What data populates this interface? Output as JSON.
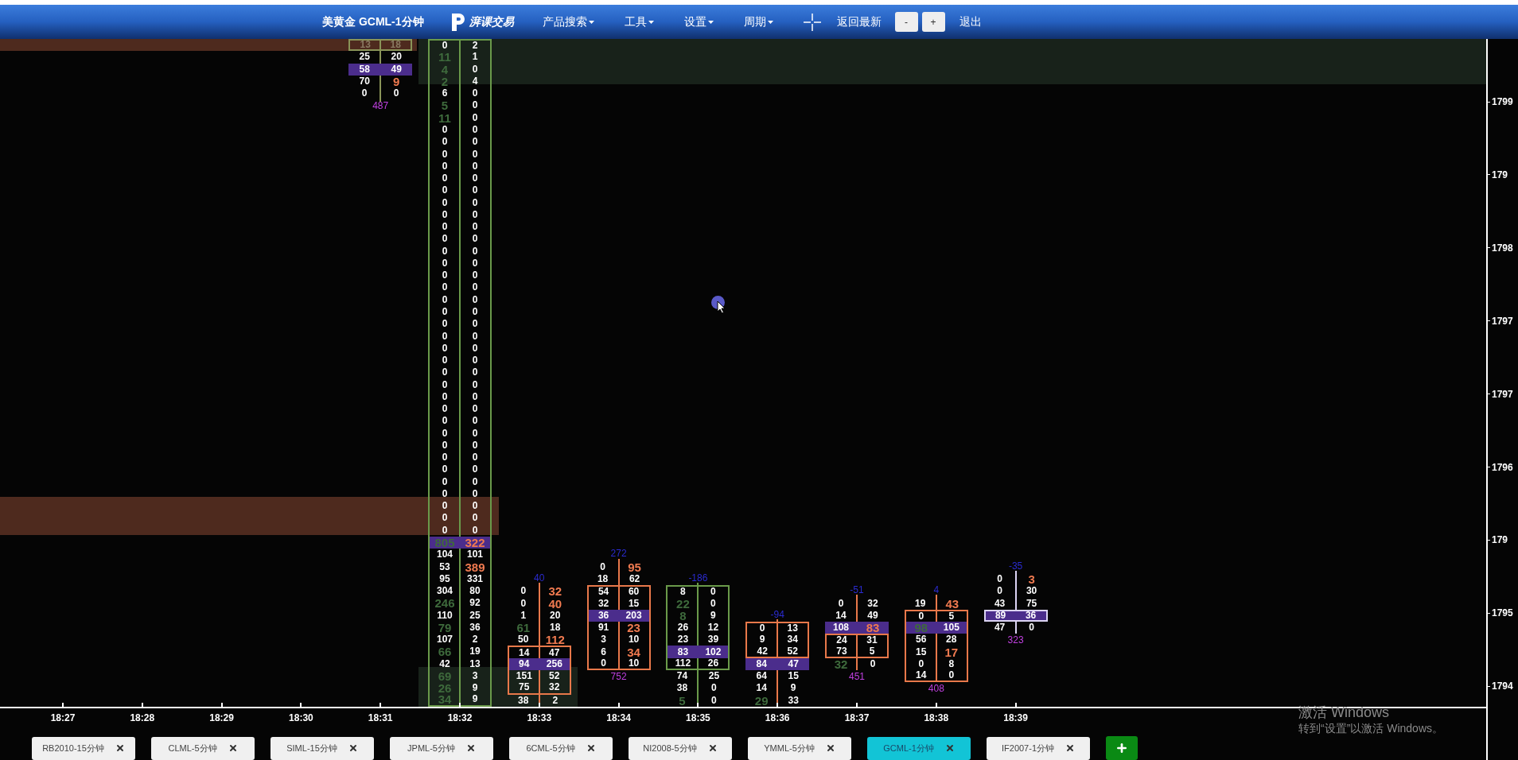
{
  "header": {
    "title": "美黄金 GCML-1分钟",
    "logo_text": "湃课交易",
    "menus": [
      {
        "label": "产品搜索",
        "dropdown": true
      },
      {
        "label": "工具",
        "dropdown": true
      },
      {
        "label": "设置",
        "dropdown": true
      },
      {
        "label": "周期",
        "dropdown": true
      }
    ],
    "reset_button": "返回最新",
    "zoom_out": "-",
    "zoom_in": "+",
    "exit": "退出"
  },
  "chart": {
    "price_labels": [
      "1799",
      "179",
      "1798",
      "1797",
      "1797",
      "1796",
      "179",
      "1795",
      "1794"
    ],
    "time_labels": [
      "18:27",
      "18:28",
      "18:29",
      "18:30",
      "18:31",
      "18:32",
      "18:33",
      "18:34",
      "18:35",
      "18:36",
      "18:37",
      "18:38",
      "18:39"
    ],
    "clusters": [
      {
        "color": "#8a9458",
        "total": "487",
        "rows": [
          {
            "cells": [
              {
                "text": "13",
                "kind": "faded"
              },
              {
                "text": "18",
                "kind": "faded"
              }
            ],
            "poc": false,
            "boxed": true
          },
          {
            "cells": [
              {
                "text": "25",
                "kind": "plain"
              },
              {
                "text": "20",
                "kind": "plain"
              }
            ],
            "poc": false,
            "boxed": false
          },
          {
            "cells": [
              {
                "text": "58",
                "kind": "plain"
              },
              {
                "text": "49",
                "kind": "plain"
              }
            ],
            "poc": true,
            "boxed": false
          },
          {
            "cells": [
              {
                "text": "70",
                "kind": "plain"
              },
              {
                "text": "9",
                "kind": "strong"
              }
            ],
            "poc": false,
            "boxed": false
          },
          {
            "cells": [
              {
                "text": "0",
                "kind": "plain"
              },
              {
                "text": "0",
                "kind": "plain"
              }
            ],
            "poc": false,
            "boxed": false
          }
        ]
      },
      {
        "color": "#6a9a4a",
        "rows": [
          {
            "cells": [
              {
                "text": "0",
                "kind": "plain"
              },
              {
                "text": "2",
                "kind": "plain"
              }
            ],
            "poc": false,
            "boxed": true
          },
          {
            "cells": [
              {
                "text": "11",
                "kind": "weak"
              },
              {
                "text": "1",
                "kind": "plain"
              }
            ],
            "poc": false,
            "boxed": true
          },
          {
            "cells": [
              {
                "text": "4",
                "kind": "weak"
              },
              {
                "text": "0",
                "kind": "plain"
              }
            ],
            "poc": false,
            "boxed": true
          },
          {
            "cells": [
              {
                "text": "2",
                "kind": "weak"
              },
              {
                "text": "4",
                "kind": "plain"
              }
            ],
            "poc": false,
            "boxed": true
          },
          {
            "cells": [
              {
                "text": "6",
                "kind": "plain"
              },
              {
                "text": "0",
                "kind": "plain"
              }
            ],
            "poc": false,
            "boxed": true
          },
          {
            "cells": [
              {
                "text": "5",
                "kind": "weak"
              },
              {
                "text": "0",
                "kind": "plain"
              }
            ],
            "poc": false,
            "boxed": true
          },
          {
            "cells": [
              {
                "text": "11",
                "kind": "weak"
              },
              {
                "text": "0",
                "kind": "plain"
              }
            ],
            "poc": false,
            "boxed": true
          },
          {
            "cells": [
              {
                "text": "0",
                "kind": "plain"
              },
              {
                "text": "0",
                "kind": "plain"
              }
            ],
            "poc": false,
            "boxed": true
          },
          {
            "cells": [
              {
                "text": "0",
                "kind": "plain"
              },
              {
                "text": "0",
                "kind": "plain"
              }
            ],
            "poc": false,
            "boxed": true
          },
          {
            "cells": [
              {
                "text": "0",
                "kind": "plain"
              },
              {
                "text": "0",
                "kind": "plain"
              }
            ],
            "poc": false,
            "boxed": true
          },
          {
            "cells": [
              {
                "text": "0",
                "kind": "plain"
              },
              {
                "text": "0",
                "kind": "plain"
              }
            ],
            "poc": false,
            "boxed": true
          },
          {
            "cells": [
              {
                "text": "0",
                "kind": "plain"
              },
              {
                "text": "0",
                "kind": "plain"
              }
            ],
            "poc": false,
            "boxed": true
          },
          {
            "cells": [
              {
                "text": "0",
                "kind": "plain"
              },
              {
                "text": "0",
                "kind": "plain"
              }
            ],
            "poc": false,
            "boxed": true
          },
          {
            "cells": [
              {
                "text": "0",
                "kind": "plain"
              },
              {
                "text": "0",
                "kind": "plain"
              }
            ],
            "poc": false,
            "boxed": true
          },
          {
            "cells": [
              {
                "text": "0",
                "kind": "plain"
              },
              {
                "text": "0",
                "kind": "plain"
              }
            ],
            "poc": false,
            "boxed": true
          },
          {
            "cells": [
              {
                "text": "0",
                "kind": "plain"
              },
              {
                "text": "0",
                "kind": "plain"
              }
            ],
            "poc": false,
            "boxed": true
          },
          {
            "cells": [
              {
                "text": "0",
                "kind": "plain"
              },
              {
                "text": "0",
                "kind": "plain"
              }
            ],
            "poc": false,
            "boxed": true
          },
          {
            "cells": [
              {
                "text": "0",
                "kind": "plain"
              },
              {
                "text": "0",
                "kind": "plain"
              }
            ],
            "poc": false,
            "boxed": true
          },
          {
            "cells": [
              {
                "text": "0",
                "kind": "plain"
              },
              {
                "text": "0",
                "kind": "plain"
              }
            ],
            "poc": false,
            "boxed": true
          },
          {
            "cells": [
              {
                "text": "0",
                "kind": "plain"
              },
              {
                "text": "0",
                "kind": "plain"
              }
            ],
            "poc": false,
            "boxed": true
          },
          {
            "cells": [
              {
                "text": "0",
                "kind": "plain"
              },
              {
                "text": "0",
                "kind": "plain"
              }
            ],
            "poc": false,
            "boxed": true
          },
          {
            "cells": [
              {
                "text": "0",
                "kind": "plain"
              },
              {
                "text": "0",
                "kind": "plain"
              }
            ],
            "poc": false,
            "boxed": true
          },
          {
            "cells": [
              {
                "text": "0",
                "kind": "plain"
              },
              {
                "text": "0",
                "kind": "plain"
              }
            ],
            "poc": false,
            "boxed": true
          },
          {
            "cells": [
              {
                "text": "0",
                "kind": "plain"
              },
              {
                "text": "0",
                "kind": "plain"
              }
            ],
            "poc": false,
            "boxed": true
          },
          {
            "cells": [
              {
                "text": "0",
                "kind": "plain"
              },
              {
                "text": "0",
                "kind": "plain"
              }
            ],
            "poc": false,
            "boxed": true
          },
          {
            "cells": [
              {
                "text": "0",
                "kind": "plain"
              },
              {
                "text": "0",
                "kind": "plain"
              }
            ],
            "poc": false,
            "boxed": true
          },
          {
            "cells": [
              {
                "text": "0",
                "kind": "plain"
              },
              {
                "text": "0",
                "kind": "plain"
              }
            ],
            "poc": false,
            "boxed": true
          },
          {
            "cells": [
              {
                "text": "0",
                "kind": "plain"
              },
              {
                "text": "0",
                "kind": "plain"
              }
            ],
            "poc": false,
            "boxed": true
          },
          {
            "cells": [
              {
                "text": "0",
                "kind": "plain"
              },
              {
                "text": "0",
                "kind": "plain"
              }
            ],
            "poc": false,
            "boxed": true
          },
          {
            "cells": [
              {
                "text": "0",
                "kind": "plain"
              },
              {
                "text": "0",
                "kind": "plain"
              }
            ],
            "poc": false,
            "boxed": true
          },
          {
            "cells": [
              {
                "text": "0",
                "kind": "plain"
              },
              {
                "text": "0",
                "kind": "plain"
              }
            ],
            "poc": false,
            "boxed": true
          },
          {
            "cells": [
              {
                "text": "0",
                "kind": "plain"
              },
              {
                "text": "0",
                "kind": "plain"
              }
            ],
            "poc": false,
            "boxed": true
          },
          {
            "cells": [
              {
                "text": "0",
                "kind": "plain"
              },
              {
                "text": "0",
                "kind": "plain"
              }
            ],
            "poc": false,
            "boxed": true
          },
          {
            "cells": [
              {
                "text": "0",
                "kind": "plain"
              },
              {
                "text": "0",
                "kind": "plain"
              }
            ],
            "poc": false,
            "boxed": true
          },
          {
            "cells": [
              {
                "text": "0",
                "kind": "plain"
              },
              {
                "text": "0",
                "kind": "plain"
              }
            ],
            "poc": false,
            "boxed": true
          },
          {
            "cells": [
              {
                "text": "0",
                "kind": "plain"
              },
              {
                "text": "0",
                "kind": "plain"
              }
            ],
            "poc": false,
            "boxed": true
          },
          {
            "cells": [
              {
                "text": "0",
                "kind": "plain"
              },
              {
                "text": "0",
                "kind": "plain"
              }
            ],
            "poc": false,
            "boxed": true
          },
          {
            "cells": [
              {
                "text": "0",
                "kind": "plain"
              },
              {
                "text": "0",
                "kind": "plain"
              }
            ],
            "poc": false,
            "boxed": true
          },
          {
            "cells": [
              {
                "text": "0",
                "kind": "plain"
              },
              {
                "text": "0",
                "kind": "plain"
              }
            ],
            "poc": false,
            "boxed": true
          },
          {
            "cells": [
              {
                "text": "0",
                "kind": "plain"
              },
              {
                "text": "0",
                "kind": "plain"
              }
            ],
            "poc": false,
            "boxed": true
          },
          {
            "cells": [
              {
                "text": "0",
                "kind": "plain"
              },
              {
                "text": "0",
                "kind": "plain"
              }
            ],
            "poc": false,
            "boxed": true
          },
          {
            "cells": [
              {
                "text": "805",
                "kind": "weak"
              },
              {
                "text": "322",
                "kind": "strong"
              }
            ],
            "poc": true,
            "boxed": true
          },
          {
            "cells": [
              {
                "text": "104",
                "kind": "plain"
              },
              {
                "text": "101",
                "kind": "plain"
              }
            ],
            "poc": false,
            "boxed": true
          },
          {
            "cells": [
              {
                "text": "53",
                "kind": "plain"
              },
              {
                "text": "389",
                "kind": "strong"
              }
            ],
            "poc": false,
            "boxed": true
          },
          {
            "cells": [
              {
                "text": "95",
                "kind": "plain"
              },
              {
                "text": "331",
                "kind": "plain"
              }
            ],
            "poc": false,
            "boxed": true
          },
          {
            "cells": [
              {
                "text": "304",
                "kind": "plain"
              },
              {
                "text": "80",
                "kind": "plain"
              }
            ],
            "poc": false,
            "boxed": true
          },
          {
            "cells": [
              {
                "text": "246",
                "kind": "weak"
              },
              {
                "text": "92",
                "kind": "plain"
              }
            ],
            "poc": false,
            "boxed": true
          },
          {
            "cells": [
              {
                "text": "110",
                "kind": "plain"
              },
              {
                "text": "25",
                "kind": "plain"
              }
            ],
            "poc": false,
            "boxed": true
          },
          {
            "cells": [
              {
                "text": "79",
                "kind": "weak"
              },
              {
                "text": "36",
                "kind": "plain"
              }
            ],
            "poc": false,
            "boxed": true
          },
          {
            "cells": [
              {
                "text": "107",
                "kind": "plain"
              },
              {
                "text": "2",
                "kind": "plain"
              }
            ],
            "poc": false,
            "boxed": true
          },
          {
            "cells": [
              {
                "text": "66",
                "kind": "weak"
              },
              {
                "text": "19",
                "kind": "plain"
              }
            ],
            "poc": false,
            "boxed": true
          },
          {
            "cells": [
              {
                "text": "42",
                "kind": "plain"
              },
              {
                "text": "13",
                "kind": "plain"
              }
            ],
            "poc": false,
            "boxed": true
          },
          {
            "cells": [
              {
                "text": "69",
                "kind": "weak"
              },
              {
                "text": "3",
                "kind": "plain"
              }
            ],
            "poc": false,
            "boxed": true
          },
          {
            "cells": [
              {
                "text": "26",
                "kind": "weak"
              },
              {
                "text": "9",
                "kind": "plain"
              }
            ],
            "poc": false,
            "boxed": true
          },
          {
            "cells": [
              {
                "text": "34",
                "kind": "weak"
              },
              {
                "text": "9",
                "kind": "plain"
              }
            ],
            "poc": false,
            "boxed": true
          }
        ]
      },
      {
        "color": "#e8784a",
        "delta": "40",
        "rows": [
          {
            "cells": [
              {
                "text": "0",
                "kind": "plain"
              },
              {
                "text": "32",
                "kind": "strong"
              }
            ],
            "poc": false,
            "boxed": false
          },
          {
            "cells": [
              {
                "text": "0",
                "kind": "plain"
              },
              {
                "text": "40",
                "kind": "strong"
              }
            ],
            "poc": false,
            "boxed": false
          },
          {
            "cells": [
              {
                "text": "1",
                "kind": "plain"
              },
              {
                "text": "20",
                "kind": "plain"
              }
            ],
            "poc": false,
            "boxed": false
          },
          {
            "cells": [
              {
                "text": "61",
                "kind": "weak"
              },
              {
                "text": "18",
                "kind": "plain"
              }
            ],
            "poc": false,
            "boxed": false
          },
          {
            "cells": [
              {
                "text": "50",
                "kind": "plain"
              },
              {
                "text": "112",
                "kind": "strong"
              }
            ],
            "poc": false,
            "boxed": false
          },
          {
            "cells": [
              {
                "text": "14",
                "kind": "plain"
              },
              {
                "text": "47",
                "kind": "plain"
              }
            ],
            "poc": false,
            "boxed": true
          },
          {
            "cells": [
              {
                "text": "94",
                "kind": "plain"
              },
              {
                "text": "256",
                "kind": "plain"
              }
            ],
            "poc": true,
            "boxed": true
          },
          {
            "cells": [
              {
                "text": "151",
                "kind": "plain"
              },
              {
                "text": "52",
                "kind": "plain"
              }
            ],
            "poc": false,
            "boxed": true
          },
          {
            "cells": [
              {
                "text": "75",
                "kind": "plain"
              },
              {
                "text": "32",
                "kind": "plain"
              }
            ],
            "poc": false,
            "boxed": true
          },
          {
            "cells": [
              {
                "text": "38",
                "kind": "plain"
              },
              {
                "text": "2",
                "kind": "plain"
              }
            ],
            "poc": false,
            "boxed": false
          }
        ]
      },
      {
        "color": "#e8784a",
        "delta": "272",
        "total": "752",
        "rows": [
          {
            "cells": [
              {
                "text": "0",
                "kind": "plain"
              },
              {
                "text": "95",
                "kind": "strong"
              }
            ],
            "poc": false,
            "boxed": false
          },
          {
            "cells": [
              {
                "text": "18",
                "kind": "plain"
              },
              {
                "text": "62",
                "kind": "plain"
              }
            ],
            "poc": false,
            "boxed": false
          },
          {
            "cells": [
              {
                "text": "54",
                "kind": "plain"
              },
              {
                "text": "60",
                "kind": "plain"
              }
            ],
            "poc": false,
            "boxed": true
          },
          {
            "cells": [
              {
                "text": "32",
                "kind": "plain"
              },
              {
                "text": "15",
                "kind": "plain"
              }
            ],
            "poc": false,
            "boxed": true
          },
          {
            "cells": [
              {
                "text": "36",
                "kind": "plain"
              },
              {
                "text": "203",
                "kind": "plain"
              }
            ],
            "poc": true,
            "boxed": true
          },
          {
            "cells": [
              {
                "text": "91",
                "kind": "plain"
              },
              {
                "text": "23",
                "kind": "strong"
              }
            ],
            "poc": false,
            "boxed": true
          },
          {
            "cells": [
              {
                "text": "3",
                "kind": "plain"
              },
              {
                "text": "10",
                "kind": "plain"
              }
            ],
            "poc": false,
            "boxed": true
          },
          {
            "cells": [
              {
                "text": "6",
                "kind": "plain"
              },
              {
                "text": "34",
                "kind": "strong"
              }
            ],
            "poc": false,
            "boxed": true
          },
          {
            "cells": [
              {
                "text": "0",
                "kind": "plain"
              },
              {
                "text": "10",
                "kind": "plain"
              }
            ],
            "poc": false,
            "boxed": true
          }
        ]
      },
      {
        "color": "#6a9a4a",
        "delta": "-186",
        "rows": [
          {
            "cells": [
              {
                "text": "8",
                "kind": "plain"
              },
              {
                "text": "0",
                "kind": "plain"
              }
            ],
            "poc": false,
            "boxed": true
          },
          {
            "cells": [
              {
                "text": "22",
                "kind": "weak"
              },
              {
                "text": "0",
                "kind": "plain"
              }
            ],
            "poc": false,
            "boxed": true
          },
          {
            "cells": [
              {
                "text": "8",
                "kind": "weak"
              },
              {
                "text": "9",
                "kind": "plain"
              }
            ],
            "poc": false,
            "boxed": true
          },
          {
            "cells": [
              {
                "text": "26",
                "kind": "plain"
              },
              {
                "text": "12",
                "kind": "plain"
              }
            ],
            "poc": false,
            "boxed": true
          },
          {
            "cells": [
              {
                "text": "23",
                "kind": "plain"
              },
              {
                "text": "39",
                "kind": "plain"
              }
            ],
            "poc": false,
            "boxed": true
          },
          {
            "cells": [
              {
                "text": "83",
                "kind": "plain"
              },
              {
                "text": "102",
                "kind": "plain"
              }
            ],
            "poc": true,
            "boxed": true
          },
          {
            "cells": [
              {
                "text": "112",
                "kind": "plain"
              },
              {
                "text": "26",
                "kind": "plain"
              }
            ],
            "poc": false,
            "boxed": true
          },
          {
            "cells": [
              {
                "text": "74",
                "kind": "plain"
              },
              {
                "text": "25",
                "kind": "plain"
              }
            ],
            "poc": false,
            "boxed": false
          },
          {
            "cells": [
              {
                "text": "38",
                "kind": "plain"
              },
              {
                "text": "0",
                "kind": "plain"
              }
            ],
            "poc": false,
            "boxed": false
          },
          {
            "cells": [
              {
                "text": "5",
                "kind": "weak"
              },
              {
                "text": "0",
                "kind": "plain"
              }
            ],
            "poc": false,
            "boxed": false
          }
        ]
      },
      {
        "color": "#e8784a",
        "delta": "-94",
        "rows": [
          {
            "cells": [
              {
                "text": "0",
                "kind": "plain"
              },
              {
                "text": "13",
                "kind": "plain"
              }
            ],
            "poc": false,
            "boxed": true
          },
          {
            "cells": [
              {
                "text": "9",
                "kind": "plain"
              },
              {
                "text": "34",
                "kind": "plain"
              }
            ],
            "poc": false,
            "boxed": true
          },
          {
            "cells": [
              {
                "text": "42",
                "kind": "plain"
              },
              {
                "text": "52",
                "kind": "plain"
              }
            ],
            "poc": false,
            "boxed": true
          },
          {
            "cells": [
              {
                "text": "84",
                "kind": "plain"
              },
              {
                "text": "47",
                "kind": "plain"
              }
            ],
            "poc": true,
            "boxed": false
          },
          {
            "cells": [
              {
                "text": "64",
                "kind": "plain"
              },
              {
                "text": "15",
                "kind": "plain"
              }
            ],
            "poc": false,
            "boxed": false
          },
          {
            "cells": [
              {
                "text": "14",
                "kind": "plain"
              },
              {
                "text": "9",
                "kind": "plain"
              }
            ],
            "poc": false,
            "boxed": false
          },
          {
            "cells": [
              {
                "text": "29",
                "kind": "weak"
              },
              {
                "text": "33",
                "kind": "plain"
              }
            ],
            "poc": false,
            "boxed": false
          }
        ]
      },
      {
        "color": "#e8784a",
        "delta": "-51",
        "total": "451",
        "rows": [
          {
            "cells": [
              {
                "text": "0",
                "kind": "plain"
              },
              {
                "text": "32",
                "kind": "plain"
              }
            ],
            "poc": false,
            "boxed": false
          },
          {
            "cells": [
              {
                "text": "14",
                "kind": "plain"
              },
              {
                "text": "49",
                "kind": "plain"
              }
            ],
            "poc": false,
            "boxed": false
          },
          {
            "cells": [
              {
                "text": "108",
                "kind": "plain"
              },
              {
                "text": "83",
                "kind": "strong"
              }
            ],
            "poc": true,
            "boxed": false
          },
          {
            "cells": [
              {
                "text": "24",
                "kind": "plain"
              },
              {
                "text": "31",
                "kind": "plain"
              }
            ],
            "poc": false,
            "boxed": true
          },
          {
            "cells": [
              {
                "text": "73",
                "kind": "plain"
              },
              {
                "text": "5",
                "kind": "plain"
              }
            ],
            "poc": false,
            "boxed": true
          },
          {
            "cells": [
              {
                "text": "32",
                "kind": "weak"
              },
              {
                "text": "0",
                "kind": "plain"
              }
            ],
            "poc": false,
            "boxed": false
          }
        ]
      },
      {
        "color": "#e8784a",
        "delta": "4",
        "total": "408",
        "rows": [
          {
            "cells": [
              {
                "text": "19",
                "kind": "plain"
              },
              {
                "text": "43",
                "kind": "strong"
              }
            ],
            "poc": false,
            "boxed": false
          },
          {
            "cells": [
              {
                "text": "0",
                "kind": "plain"
              },
              {
                "text": "5",
                "kind": "plain"
              }
            ],
            "poc": false,
            "boxed": true
          },
          {
            "cells": [
              {
                "text": "98",
                "kind": "weak"
              },
              {
                "text": "105",
                "kind": "plain"
              }
            ],
            "poc": true,
            "boxed": true
          },
          {
            "cells": [
              {
                "text": "56",
                "kind": "plain"
              },
              {
                "text": "28",
                "kind": "plain"
              }
            ],
            "poc": false,
            "boxed": true
          },
          {
            "cells": [
              {
                "text": "15",
                "kind": "plain"
              },
              {
                "text": "17",
                "kind": "strong"
              }
            ],
            "poc": false,
            "boxed": true
          },
          {
            "cells": [
              {
                "text": "0",
                "kind": "plain"
              },
              {
                "text": "8",
                "kind": "plain"
              }
            ],
            "poc": false,
            "boxed": true
          },
          {
            "cells": [
              {
                "text": "14",
                "kind": "plain"
              },
              {
                "text": "0",
                "kind": "plain"
              }
            ],
            "poc": false,
            "boxed": true
          }
        ]
      },
      {
        "color": "#dcd4f4",
        "delta": "-35",
        "total": "323",
        "rows": [
          {
            "cells": [
              {
                "text": "0",
                "kind": "plain"
              },
              {
                "text": "3",
                "kind": "strong"
              }
            ],
            "poc": false,
            "boxed": false
          },
          {
            "cells": [
              {
                "text": "0",
                "kind": "plain"
              },
              {
                "text": "30",
                "kind": "plain"
              }
            ],
            "poc": false,
            "boxed": false
          },
          {
            "cells": [
              {
                "text": "43",
                "kind": "plain"
              },
              {
                "text": "75",
                "kind": "plain"
              }
            ],
            "poc": false,
            "boxed": false
          },
          {
            "cells": [
              {
                "text": "89",
                "kind": "plain"
              },
              {
                "text": "36",
                "kind": "plain"
              }
            ],
            "poc": true,
            "boxed": true
          },
          {
            "cells": [
              {
                "text": "47",
                "kind": "plain"
              },
              {
                "text": "0",
                "kind": "plain"
              }
            ],
            "poc": false,
            "boxed": false
          }
        ]
      }
    ]
  },
  "tabs": [
    {
      "label": "RB2010-15分钟",
      "selected": false
    },
    {
      "label": "CLML-5分钟",
      "selected": false
    },
    {
      "label": "SIML-15分钟",
      "selected": false
    },
    {
      "label": "JPML-5分钟",
      "selected": false
    },
    {
      "label": "6CML-5分钟",
      "selected": false
    },
    {
      "label": "NI2008-5分钟",
      "selected": false
    },
    {
      "label": "YMML-5分钟",
      "selected": false
    },
    {
      "label": "GCML-1分钟",
      "selected": true
    },
    {
      "label": "IF2007-1分钟",
      "selected": false
    }
  ],
  "os_watermark": {
    "title": "激活 Windows",
    "subtitle": "转到“设置”以激活 Windows。"
  }
}
